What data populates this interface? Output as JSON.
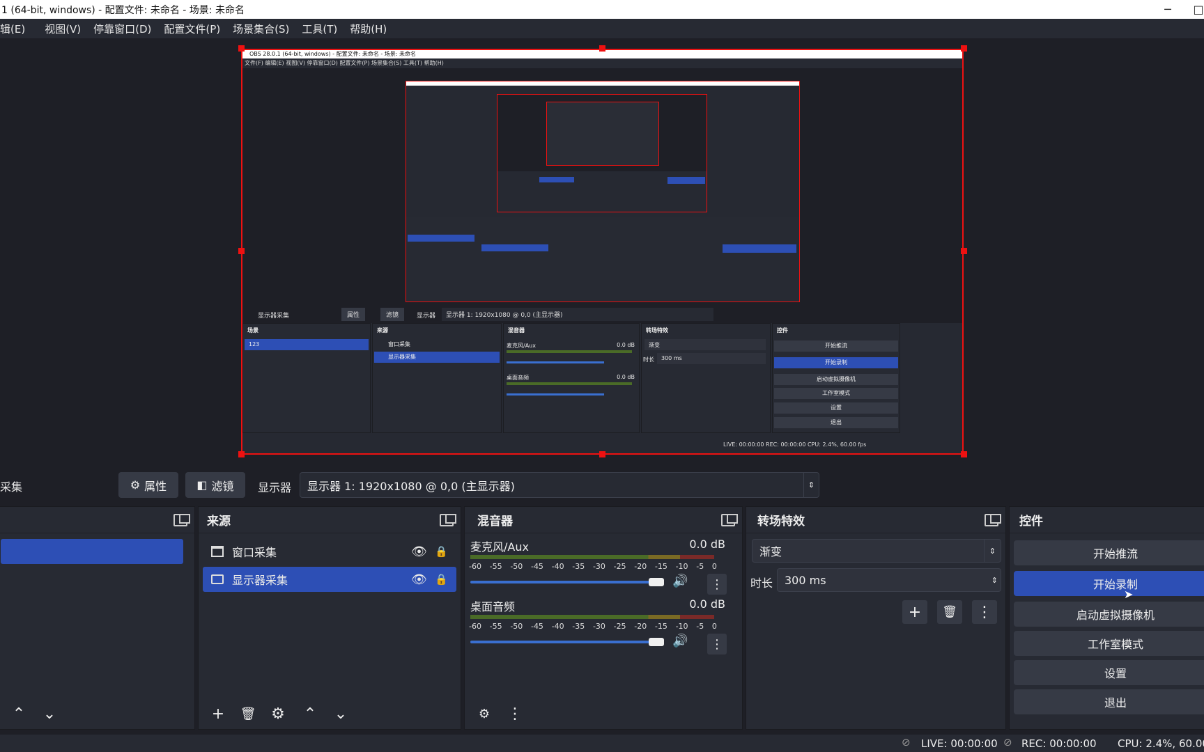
{
  "window": {
    "title": "1 (64-bit, windows) - 配置文件: 未命名 - 场景: 未命名",
    "minimize": "─",
    "maximize": "□"
  },
  "menu": [
    "辑(E)",
    "视图(V)",
    "停靠窗口(D)",
    "配置文件(P)",
    "场景集合(S)",
    "工具(T)",
    "帮助(H)"
  ],
  "nested": {
    "title": "OBS 28.0.1 (64-bit, windows) - 配置文件: 未命名 - 场景: 未命名",
    "menu": "文件(F)    编辑(E)    视图(V)    停靠窗口(D)    配置文件(P)    场景集合(S)    工具(T)    帮助(H)",
    "source_label": "显示器采集",
    "props": "属性",
    "filters": "滤镜",
    "display_label": "显示器",
    "display_value": "显示器 1: 1920x1080 @ 0,0 (主显示器)",
    "scenes_title": "场景",
    "scene_item": "123",
    "sources_title": "来源",
    "source1": "窗口采集",
    "source2": "显示器采集",
    "mixer_title": "混音器",
    "mic": "麦克风/Aux",
    "desktop": "桌面音频",
    "db": "0.0 dB",
    "trans_title": "转场特效",
    "trans": "渐变",
    "duration_label": "时长",
    "duration": "300 ms",
    "controls_title": "控件",
    "c1": "开始推流",
    "c2": "开始录制",
    "c3": "启动虚拟摄像机",
    "c4": "工作室模式",
    "c5": "设置",
    "c6": "退出",
    "status": "LIVE: 00:00:00    REC: 00:00:00    CPU: 2.4%, 60.00 fps"
  },
  "toolbar": {
    "source_name": "采集",
    "properties": "属性",
    "filters": "滤镜",
    "display_label": "显示器",
    "display_value": "显示器 1: 1920x1080 @ 0,0 (主显示器)"
  },
  "sources": {
    "title": "来源",
    "items": [
      {
        "label": "窗口采集",
        "selected": false
      },
      {
        "label": "显示器采集",
        "selected": true
      }
    ]
  },
  "mixer": {
    "title": "混音器",
    "channels": [
      {
        "label": "麦克风/Aux",
        "db": "0.0 dB"
      },
      {
        "label": "桌面音频",
        "db": "0.0 dB"
      }
    ],
    "scale": [
      "-60",
      "-55",
      "-50",
      "-45",
      "-40",
      "-35",
      "-30",
      "-25",
      "-20",
      "-15",
      "-10",
      "-5",
      "0"
    ]
  },
  "transitions": {
    "title": "转场特效",
    "selected": "渐变",
    "duration_label": "时长",
    "duration": "300 ms"
  },
  "controls": {
    "title": "控件",
    "buttons": [
      "开始推流",
      "开始录制",
      "启动虚拟摄像机",
      "工作室模式",
      "设置",
      "退出"
    ]
  },
  "status": {
    "live": "LIVE: 00:00:00",
    "rec": "REC: 00:00:00",
    "cpu": "CPU: 2.4%, 60.00"
  },
  "colors": {
    "accent": "#2d4fb5",
    "selection_border": "#ee1111"
  }
}
